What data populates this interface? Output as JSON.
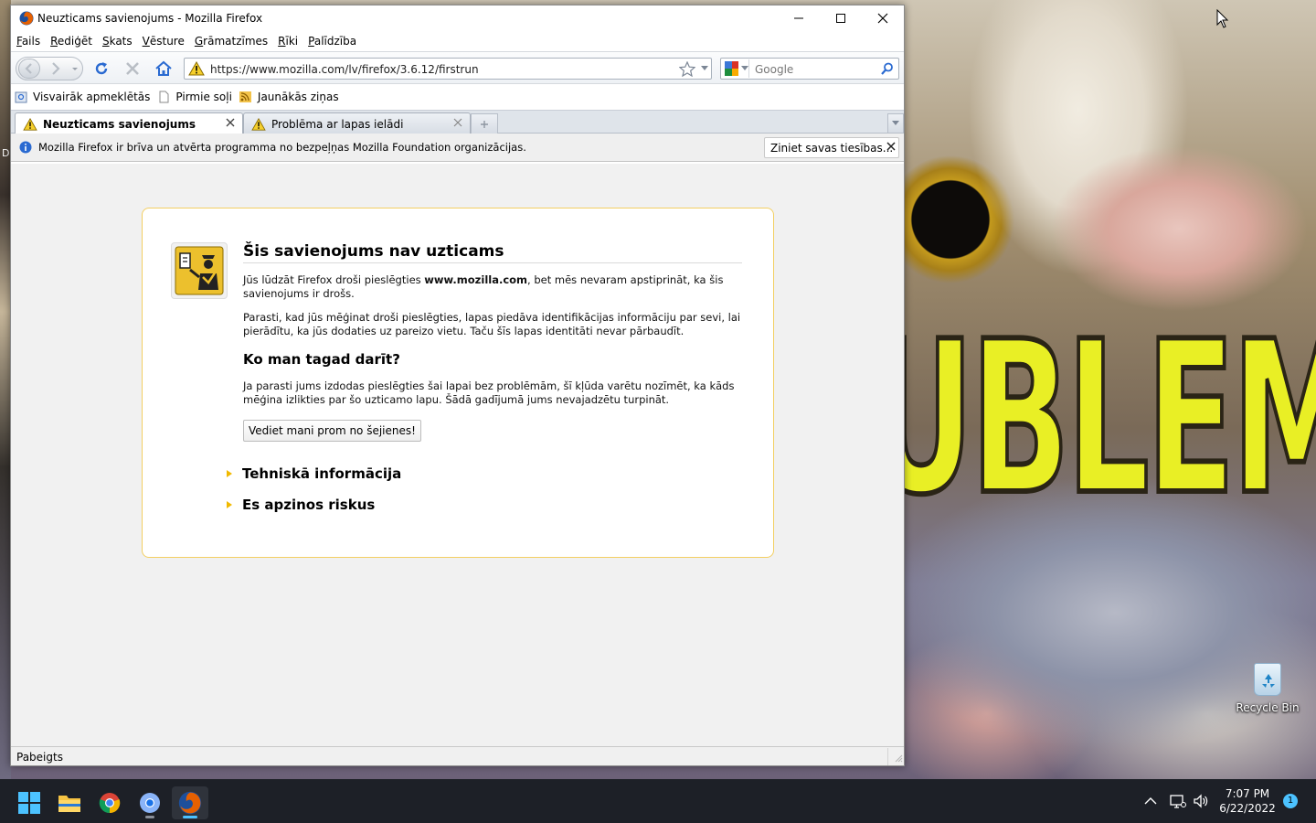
{
  "window": {
    "title": "Neuzticams savienojums - Mozilla Firefox"
  },
  "menu": [
    "Fails",
    "Rediģēt",
    "Skats",
    "Vēsture",
    "Grāmatzīmes",
    "Rīki",
    "Palīdzība"
  ],
  "navbar": {
    "url": "https://www.mozilla.com/lv/firefox/3.6.12/firstrun",
    "search_placeholder": "Google"
  },
  "bookmarks": [
    "Visvairāk apmeklētās",
    "Pirmie soļi",
    "Jaunākās ziņas"
  ],
  "tabs": [
    {
      "label": "Neuzticams savienojums",
      "active": true
    },
    {
      "label": "Problēma ar lapas ielādi",
      "active": false
    }
  ],
  "notification": {
    "message": "Mozilla Firefox ir brīva un atvērta programma no bezpeļņas Mozilla Foundation organizācijas.",
    "button": "Ziniet savas tiesības..."
  },
  "error": {
    "title": "Šis savienojums nav uzticams",
    "p1_before": "Jūs lūdzāt Firefox droši pieslēgties ",
    "p1_host": "www.mozilla.com",
    "p1_after": ", bet mēs nevaram apstiprināt, ka šis savienojums ir drošs.",
    "p2": "Parasti, kad jūs mēģinat droši pieslēgties, lapas piedāva identifikācijas informāciju par sevi, lai pierādītu, ka jūs dodaties uz pareizo vietu. Taču šīs lapas identitāti nevar pārbaudīt.",
    "subtitle": "Ko man tagad darīt?",
    "p3": "Ja parasti jums izdodas pieslēgties šai lapai bez problēmām, šī kļūda varētu nozīmēt, ka kāds mēģina izlikties par šo uzticamo lapu. Šādā gadījumā jums nevajadzētu turpināt.",
    "button": "Vediet mani prom no šejienes!",
    "expander_tech": "Tehniskā informācija",
    "expander_risk": "Es apzinos riskus"
  },
  "status": "Pabeigts",
  "desktop": {
    "recycle_bin": "Recycle Bin",
    "wallpaper_text": "UBLEM",
    "left_label": "D"
  },
  "taskbar": {
    "time": "7:07 PM",
    "date": "6/22/2022",
    "notifications": "1"
  },
  "colors": {
    "error_border": "#f3cf62",
    "expander_arrow": "#f1b900",
    "taskbar": "#1d2027",
    "accent": "#4cc2ff"
  }
}
